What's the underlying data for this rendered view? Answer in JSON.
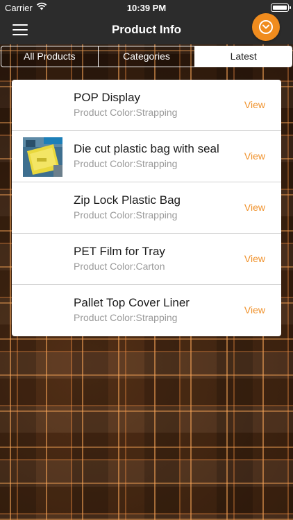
{
  "status_bar": {
    "carrier": "Carrier",
    "time": "10:39 PM"
  },
  "nav": {
    "title": "Product Info",
    "accent_color": "#f08c1e"
  },
  "tabs": [
    {
      "label": "All Products",
      "active": false
    },
    {
      "label": "Categories",
      "active": false
    },
    {
      "label": "Latest",
      "active": true
    }
  ],
  "products": [
    {
      "name": "POP Display",
      "subtitle": "Product Color:Strapping",
      "action": "View",
      "has_image": false
    },
    {
      "name": "Die cut plastic bag with seal",
      "subtitle": "Product Color:Strapping",
      "action": "View",
      "has_image": true
    },
    {
      "name": "Zip Lock Plastic Bag",
      "subtitle": "Product Color:Strapping",
      "action": "View",
      "has_image": false
    },
    {
      "name": "PET Film for Tray",
      "subtitle": "Product Color:Carton",
      "action": "View",
      "has_image": false
    },
    {
      "name": "Pallet Top Cover Liner",
      "subtitle": "Product Color:Strapping",
      "action": "View",
      "has_image": false
    }
  ],
  "colors": {
    "view_link": "#f0922c",
    "bar_background": "#2c2c2c",
    "background": "#4a2a14"
  }
}
